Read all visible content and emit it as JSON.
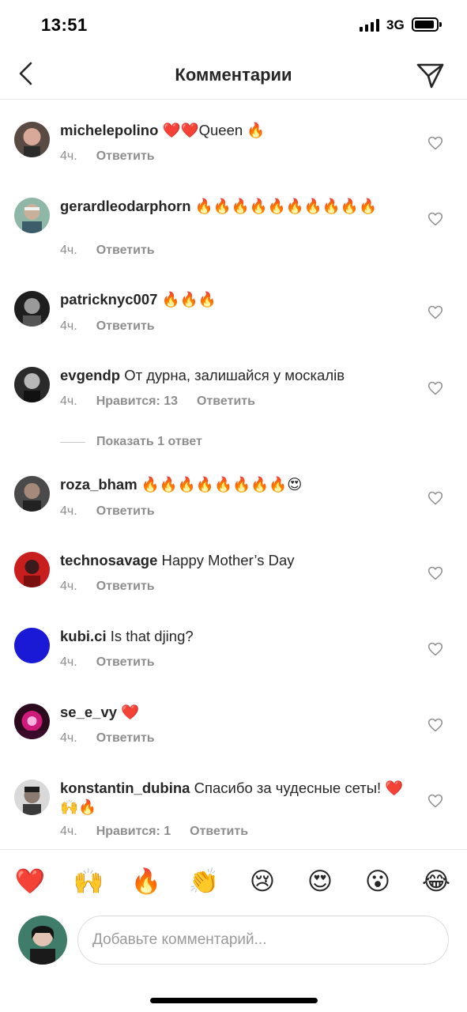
{
  "status": {
    "time": "13:51",
    "network": "3G"
  },
  "header": {
    "title": "Комментарии",
    "back_icon": "chevron-left-icon",
    "share_icon": "paper-plane-icon"
  },
  "comments": [
    {
      "username": "michelepolino",
      "text": "❤️❤️Queen 🔥",
      "time": "4ч.",
      "reply": "Ответить"
    },
    {
      "username": "gerardleodarphorn",
      "text": "🔥🔥🔥🔥🔥🔥🔥🔥🔥🔥",
      "time": "4ч.",
      "reply": "Ответить"
    },
    {
      "username": "patricknyc007",
      "text": "🔥🔥🔥",
      "time": "4ч.",
      "reply": "Ответить"
    },
    {
      "username": "evgendp",
      "text": "От дурна, залишайся у москалів",
      "time": "4ч.",
      "likes": "Нравится: 13",
      "reply": "Ответить"
    },
    {
      "username": "roza_bham",
      "text": "🔥🔥🔥🔥🔥🔥🔥🔥😍",
      "time": "4ч.",
      "reply": "Ответить"
    },
    {
      "username": "technosavage",
      "text": "Happy Mother’s Day",
      "time": "4ч.",
      "reply": "Ответить"
    },
    {
      "username": "kubi.ci",
      "text": "Is that djing?",
      "time": "4ч.",
      "reply": "Ответить"
    },
    {
      "username": "se_e_vy",
      "text": "❤️",
      "time": "4ч.",
      "reply": "Ответить"
    },
    {
      "username": "konstantin_dubina",
      "text": "Спасибо за чудесные сеты! ❤️🙌🔥",
      "time": "4ч.",
      "likes": "Нравится: 1",
      "reply": "Ответить"
    }
  ],
  "show_replies": "Показать 1 ответ",
  "quick_emojis": [
    "❤️",
    "🙌",
    "🔥",
    "👏",
    "😢",
    "😍",
    "😮",
    "😂"
  ],
  "composer": {
    "placeholder": "Добавьте комментарий..."
  },
  "colors": {
    "text": "#262626",
    "secondary": "#8e8e8e",
    "divider": "#e6e6e6",
    "avatar_blue": "#1a1ad6"
  }
}
